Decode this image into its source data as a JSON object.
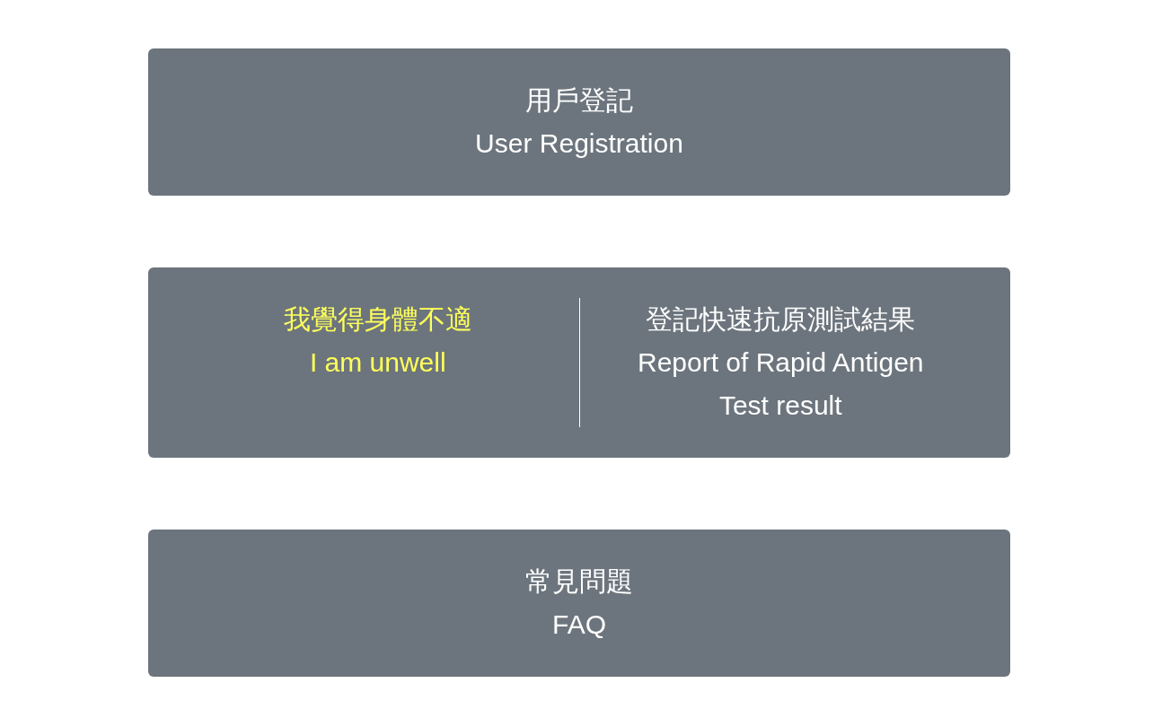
{
  "menu": [
    {
      "kind": "single",
      "title_zh": "用戶登記",
      "title_en": "User Registration",
      "highlighted": false
    },
    {
      "kind": "split",
      "options": [
        {
          "title_zh": "我覺得身體不適",
          "title_en": "I am unwell",
          "highlighted": true
        },
        {
          "title_zh": "登記快速抗原測試結果",
          "title_en": "Report of Rapid Antigen Test result",
          "highlighted": false
        }
      ]
    },
    {
      "kind": "single",
      "title_zh": "常見問題",
      "title_en": "FAQ",
      "highlighted": false
    }
  ]
}
